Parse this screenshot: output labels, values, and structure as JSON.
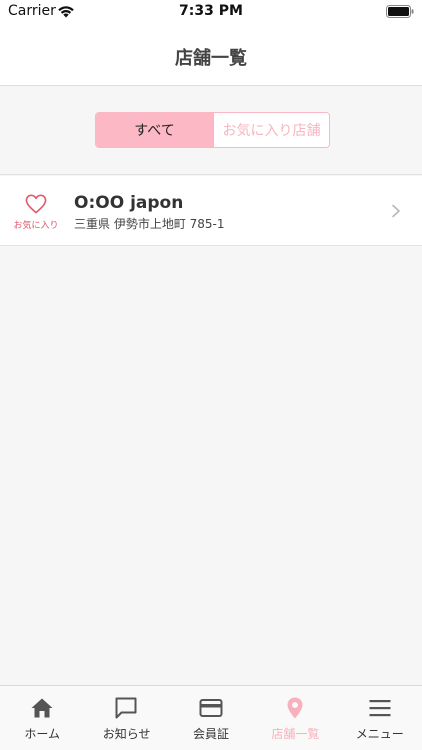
{
  "status_bar": {
    "carrier": "Carrier",
    "time": "7:33 PM"
  },
  "nav": {
    "title": "店舗一覧"
  },
  "segment": {
    "options": [
      "すべて",
      "お気に入り店舗"
    ],
    "selected": "すべて"
  },
  "stores": [
    {
      "favorite_label": "お気に入り",
      "name": "O:OO japon",
      "address": "三重県 伊勢市上地町 785-1"
    }
  ],
  "tabs": [
    {
      "label": "ホーム",
      "icon": "home-icon"
    },
    {
      "label": "お知らせ",
      "icon": "speech-bubble-icon"
    },
    {
      "label": "会員証",
      "icon": "membership-card-icon"
    },
    {
      "label": "店舗一覧",
      "icon": "map-pin-icon",
      "active": true
    },
    {
      "label": "メニュー",
      "icon": "hamburger-menu-icon"
    }
  ],
  "colors": {
    "accent_pink": "#fcb8c4",
    "favorite_red": "#e05a6e",
    "tab_icon_gray": "#555555"
  }
}
